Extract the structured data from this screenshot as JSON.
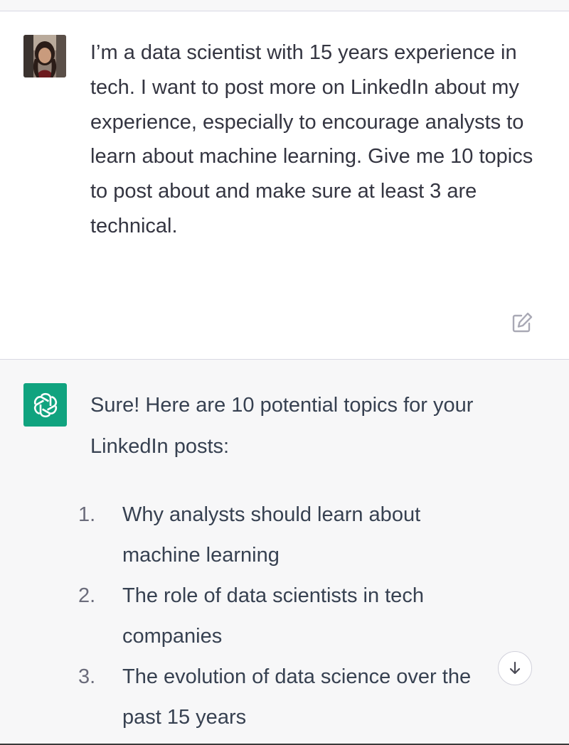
{
  "user_message": {
    "text": "I’m a data scientist with 15 years experience in tech. I want to post more on LinkedIn about my experience, especially to encourage analysts to learn about machine learning. Give me 10 topics to post about and make sure at least 3 are technical."
  },
  "assistant_message": {
    "intro": "Sure! Here are 10 potential topics for your LinkedIn posts:",
    "topics": [
      {
        "number": "1.",
        "text": "Why analysts should learn about machine learning"
      },
      {
        "number": "2.",
        "text": "The role of data scientists in tech companies"
      },
      {
        "number": "3.",
        "text": "The evolution of data science over the past 15 years"
      }
    ]
  },
  "icons": {
    "edit": "edit-icon",
    "assistant_logo": "openai-logo-icon",
    "scroll_down": "arrow-down-icon"
  },
  "colors": {
    "accent": "#10a37f",
    "user_bg": "#ffffff",
    "assistant_bg": "#f7f7f8",
    "text": "#343541"
  }
}
